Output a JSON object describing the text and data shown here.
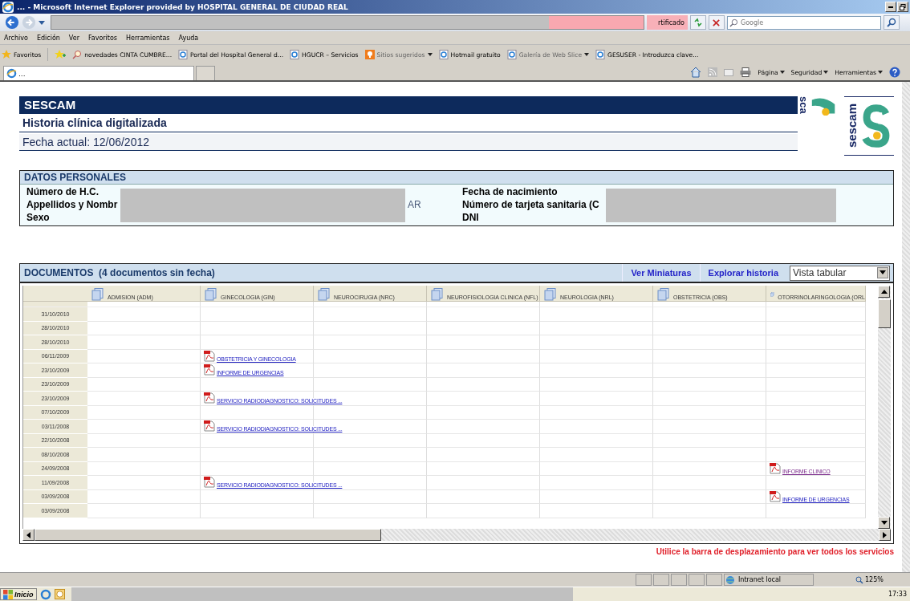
{
  "browser": {
    "title": "... - Microsoft Internet Explorer provided by HOSPITAL GENERAL DE CIUDAD REAL",
    "certificate": "rtificado",
    "search_placeholder": "Google",
    "menu": [
      "Archivo",
      "Edición",
      "Ver",
      "Favoritos",
      "Herramientas",
      "Ayuda"
    ],
    "favorites_label": "Favoritos",
    "favorites": [
      {
        "label": "novedades CINTA CUMBRE...",
        "kind": "search",
        "disabled": false,
        "dropdown": false
      },
      {
        "label": "Portal del Hospital General d...",
        "kind": "page",
        "disabled": false,
        "dropdown": false
      },
      {
        "label": "HGUCR – Servicios",
        "kind": "page",
        "disabled": false,
        "dropdown": false
      },
      {
        "label": "Sitios sugeridos",
        "kind": "suggest",
        "disabled": true,
        "dropdown": true
      },
      {
        "label": "Hotmail gratuito",
        "kind": "page",
        "disabled": false,
        "dropdown": false
      },
      {
        "label": "Galería de Web Slice",
        "kind": "page",
        "disabled": true,
        "dropdown": true
      },
      {
        "label": "GESUSER - Introduzca clave...",
        "kind": "page",
        "disabled": false,
        "dropdown": false
      }
    ],
    "tab_label": "...",
    "commands": [
      "Página",
      "Seguridad",
      "Herramientas"
    ],
    "status_zone": "Intranet local",
    "zoom": "125%",
    "start": "Inicio",
    "clock": "17:33"
  },
  "page": {
    "org": "SESCAM",
    "title": "Historia clínica digitalizada",
    "date_line": "Fecha actual: 12/06/2012",
    "logo_text": "sescam",
    "logo_side_text": "sca"
  },
  "personal": {
    "heading": "DATOS PERSONALES",
    "fields": [
      {
        "label": "Número de H.C."
      },
      {
        "label": "Fecha de nacimiento"
      },
      {
        "label": "Appellidos y Nombr",
        "value": "AR"
      },
      {
        "label": "Número de tarjeta sanitaria (C"
      },
      {
        "label": "Sexo"
      },
      {
        "label": "DNI"
      }
    ]
  },
  "documents": {
    "heading": "DOCUMENTOS  (4 documentos sin fecha)",
    "links": [
      "Ver Miniaturas",
      "Explorar historia"
    ],
    "view": "Vista tabular",
    "columns": [
      "ADMISION (ADM)",
      "GINECOLOGIA (GIN)",
      "NEUROCIRUGIA (NRC)",
      "NEUROFISIOLOGIA CLINICA (NFL)",
      "NEUROLOGIA (NRL)",
      "OBSTETRICIA (OBS)",
      "OTORRINOLARINGOLOGIA (ORL"
    ],
    "rows": [
      {
        "date": "31/10/2010",
        "cells": [
          null,
          null,
          null,
          null,
          null,
          null,
          null
        ]
      },
      {
        "date": "28/10/2010",
        "cells": [
          null,
          null,
          null,
          null,
          null,
          null,
          null
        ]
      },
      {
        "date": "28/10/2010",
        "cells": [
          null,
          null,
          null,
          null,
          null,
          null,
          null
        ]
      },
      {
        "date": "06/11/2009",
        "cells": [
          null,
          {
            "title": "OBSTETRICIA Y GINECOLOGIA",
            "visited": false
          },
          null,
          null,
          null,
          null,
          null
        ]
      },
      {
        "date": "23/10/2009",
        "cells": [
          null,
          {
            "title": "INFORME DE URGENCIAS",
            "visited": false
          },
          null,
          null,
          null,
          null,
          null
        ]
      },
      {
        "date": "23/10/2009",
        "cells": [
          null,
          null,
          null,
          null,
          null,
          null,
          null
        ]
      },
      {
        "date": "23/10/2009",
        "cells": [
          null,
          {
            "title": "SERVICIO RADIODIAGNOSTICO: SOLICITUDES ...",
            "visited": false
          },
          null,
          null,
          null,
          null,
          null
        ]
      },
      {
        "date": "07/10/2009",
        "cells": [
          null,
          null,
          null,
          null,
          null,
          null,
          null
        ]
      },
      {
        "date": "03/11/2008",
        "cells": [
          null,
          {
            "title": "SERVICIO RADIODIAGNOSTICO: SOLICITUDES ...",
            "visited": false
          },
          null,
          null,
          null,
          null,
          null
        ]
      },
      {
        "date": "22/10/2008",
        "cells": [
          null,
          null,
          null,
          null,
          null,
          null,
          null
        ]
      },
      {
        "date": "08/10/2008",
        "cells": [
          null,
          null,
          null,
          null,
          null,
          null,
          null
        ]
      },
      {
        "date": "24/09/2008",
        "cells": [
          null,
          null,
          null,
          null,
          null,
          null,
          {
            "title": "INFORME CLINICO",
            "visited": true
          }
        ]
      },
      {
        "date": "11/09/2008",
        "cells": [
          null,
          {
            "title": "SERVICIO RADIODIAGNOSTICO: SOLICITUDES ...",
            "visited": false
          },
          null,
          null,
          null,
          null,
          null
        ]
      },
      {
        "date": "03/09/2008",
        "cells": [
          null,
          null,
          null,
          null,
          null,
          null,
          {
            "title": "INFORME DE URGENCIAS",
            "visited": false
          }
        ]
      },
      {
        "date": "03/09/2008",
        "cells": [
          null,
          null,
          null,
          null,
          null,
          null,
          null
        ]
      }
    ],
    "note": "Utilice la barra de desplazamiento para ver todos los servicios"
  }
}
